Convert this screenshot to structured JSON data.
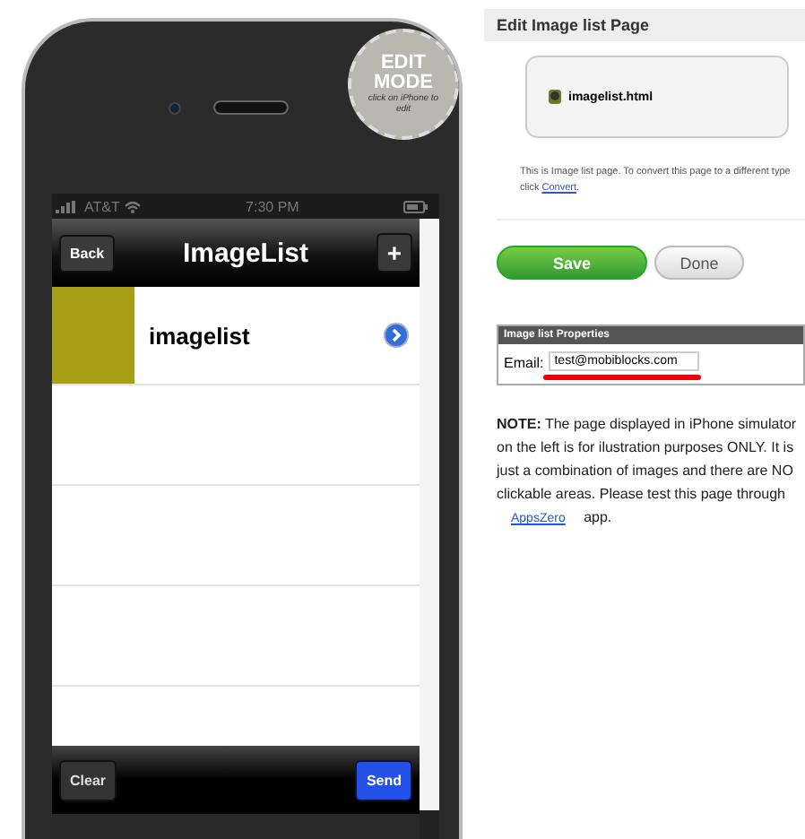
{
  "phone": {
    "badge": {
      "line_1": "EDIT",
      "line_2": "MODE",
      "caption": "click on iPhone to edit"
    },
    "status_bar": {
      "carrier": "AT&T",
      "time": "7:30 PM"
    },
    "nav_bar": {
      "back": "Back",
      "title": "ImageList",
      "add": "+"
    },
    "rows": [
      {
        "label": "imagelist"
      }
    ],
    "toolbar": {
      "left": "Clear",
      "right": "Send"
    }
  },
  "panel": {
    "title": "Edit Image list Page",
    "file": "imagelist.html",
    "description": "This is Image list page. To convert this page to a different type click",
    "convert_link": "Convert",
    "description_end": ".",
    "buttons": [
      {
        "label": "Save",
        "kind": "primary"
      },
      {
        "label": "Done",
        "kind": "secondary"
      }
    ],
    "properties": {
      "header": "Image list Properties",
      "fields": [
        {
          "label": "Email:",
          "value": "test@mobiblocks.com"
        }
      ]
    },
    "note": "**NOTE:** The page displayed in iPhone simulator on the left is for ilustration purposes ONLY. It is just a combination of images and there are NO clickable areas. Please test this page through",
    "app_link": "AppsZero",
    "app_suffix": "app."
  }
}
